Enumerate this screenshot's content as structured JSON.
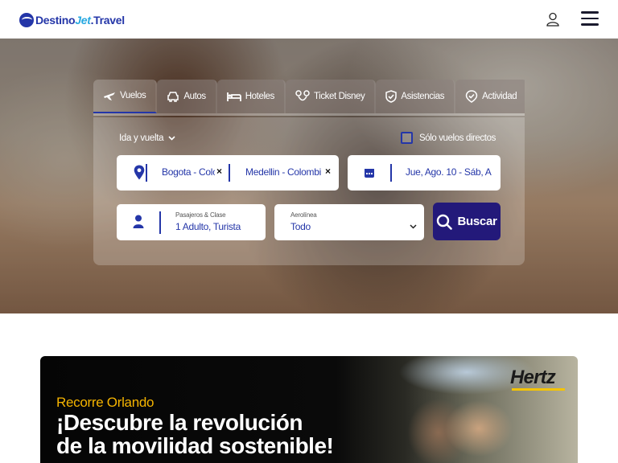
{
  "header": {
    "logo": {
      "part1": "Destino",
      "part2": "Jet",
      "part3": ".Travel"
    },
    "icons": {
      "user": "user-icon",
      "menu": "hamburger-menu-icon"
    }
  },
  "tabs": [
    {
      "label": "Vuelos",
      "icon": "plane-icon",
      "active": true
    },
    {
      "label": "Autos",
      "icon": "car-icon",
      "active": false
    },
    {
      "label": "Hoteles",
      "icon": "bed-icon",
      "active": false
    },
    {
      "label": "Ticket Disney",
      "icon": "mouse-ears-icon",
      "active": false
    },
    {
      "label": "Asistencias",
      "icon": "shield-check-icon",
      "active": false
    },
    {
      "label": "Actividad",
      "icon": "map-pin-check-icon",
      "active": false
    }
  ],
  "search": {
    "trip_type": "Ida y vuelta",
    "direct_flights_label": "Sólo vuelos directos",
    "origin": "Bogota - Colc",
    "destination": "Medellin - Colombi",
    "dates": "Jue, Ago. 10  - Sáb, A",
    "clear_symbol": "×",
    "passengers_label": "Pasajeros & Clase",
    "passengers_value": "1 Adulto, Turista",
    "airline_label": "Aerolínea",
    "airline_value": "Todo",
    "search_button": "Buscar"
  },
  "banner": {
    "kicker": "Recorre Orlando",
    "title_line1": "¡Descubre la revolución",
    "title_line2": "de la movilidad sostenible!",
    "brand": "Hertz"
  },
  "colors": {
    "brand_blue": "#2436a8",
    "brand_light_blue": "#27a8e0",
    "button_navy": "#23197a",
    "banner_accent": "#f5b400"
  }
}
